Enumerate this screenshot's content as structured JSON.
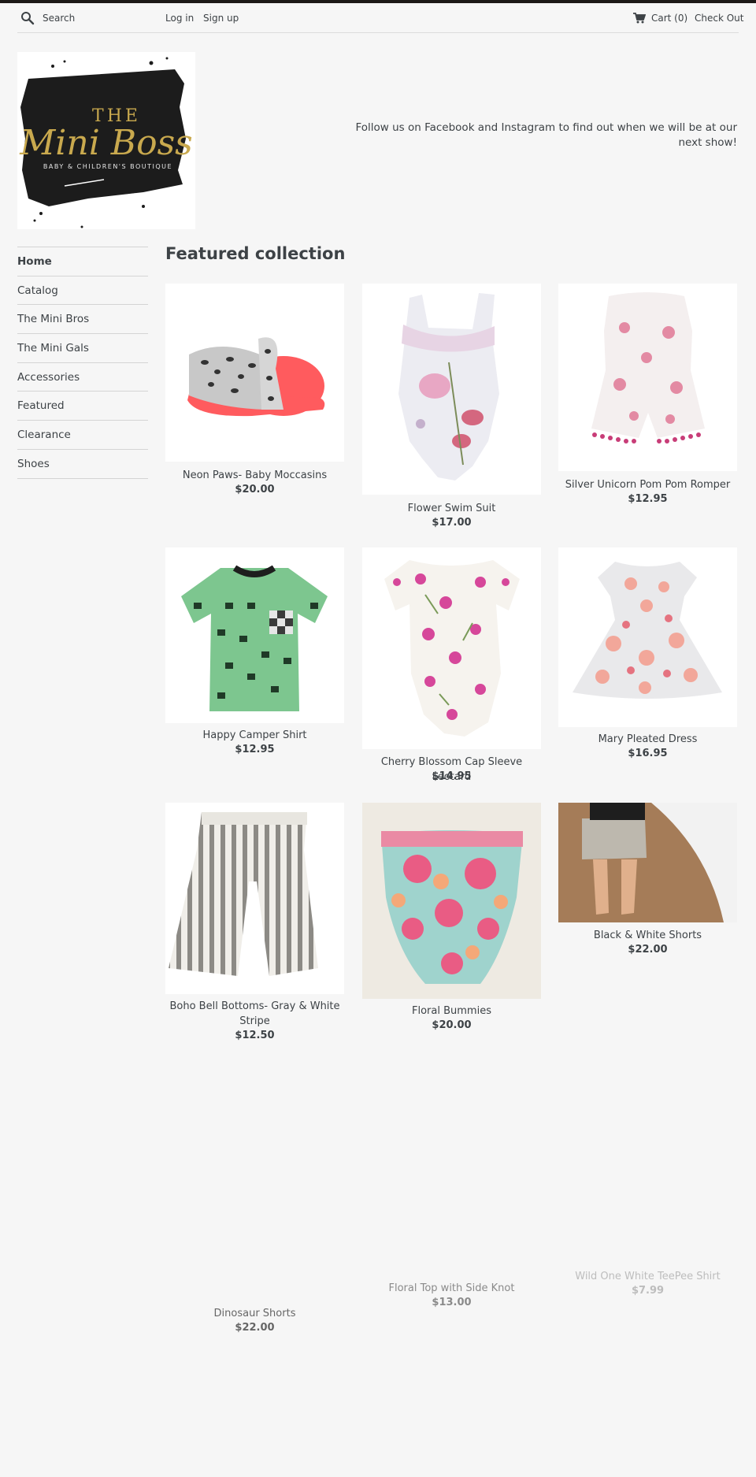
{
  "header": {
    "search_placeholder": "Search",
    "login_label": "Log in",
    "signup_label": "Sign up",
    "cart_label": "Cart (0)",
    "checkout_label": "Check Out"
  },
  "logo": {
    "line1": "THE",
    "line2": "Mini Boss",
    "line3": "BABY & CHILDREN'S BOUTIQUE"
  },
  "tagline": "Follow us on Facebook and Instagram to find out when we will be at our next show!",
  "nav": {
    "items": [
      {
        "label": "Home"
      },
      {
        "label": "Catalog"
      },
      {
        "label": "The Mini Bros"
      },
      {
        "label": "The Mini Gals"
      },
      {
        "label": "Accessories"
      },
      {
        "label": "Featured"
      },
      {
        "label": "Clearance"
      },
      {
        "label": "Shoes"
      }
    ]
  },
  "collection": {
    "title": "Featured collection",
    "products": [
      {
        "name": "Neon Paws- Baby Moccasins",
        "price": "$20.00",
        "image": "leopard-moccasins-image"
      },
      {
        "name": "Flower Swim Suit",
        "price": "$17.00",
        "image": "floral-swimsuit-image"
      },
      {
        "name": "Silver Unicorn Pom Pom Romper",
        "price": "$12.95",
        "image": "unicorn-romper-image"
      },
      {
        "name": "Happy Camper Shirt",
        "price": "$12.95",
        "image": "green-camper-shirt-image"
      },
      {
        "name": "Cherry Blossom Cap Sleeve Leotard",
        "price": "$14.95",
        "image": "cherry-blossom-leotard-image"
      },
      {
        "name": "Mary Pleated Dress",
        "price": "$16.95",
        "image": "floral-dress-image"
      },
      {
        "name": "Boho Bell Bottoms- Gray & White Stripe",
        "price": "$12.50",
        "image": "striped-bell-bottoms-image"
      },
      {
        "name": "Floral Bummies",
        "price": "$20.00",
        "image": "floral-bummies-image"
      },
      {
        "name": "Black & White Shorts",
        "price": "$22.00",
        "image": "black-white-shorts-photo"
      },
      {
        "name": "Dinosaur Shorts",
        "price": "$22.00"
      },
      {
        "name": "Floral Top with Side Knot",
        "price": "$13.00"
      },
      {
        "name": "Wild One White TeePee Shirt",
        "price": "$7.99"
      }
    ]
  },
  "colors": {
    "background": "#f6f6f6",
    "text": "#3d4246",
    "topbar": "#1c1917",
    "logo_gold": "#c9a94e"
  }
}
